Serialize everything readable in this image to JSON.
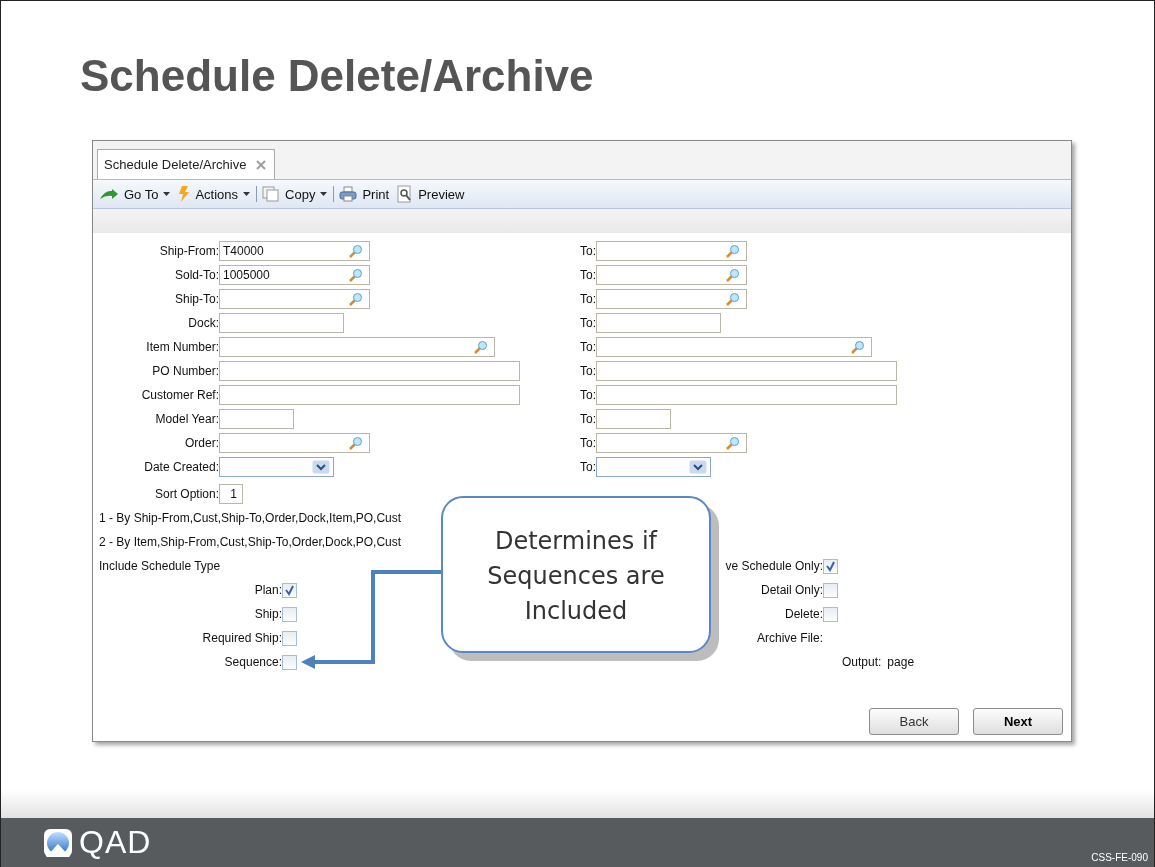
{
  "slide": {
    "title": "Schedule Delete/Archive",
    "logo": "QAD",
    "code": "CSS-FE-090"
  },
  "window": {
    "tabs": [
      {
        "label": "Schedule Delete/Archive",
        "selected": true
      }
    ],
    "toolbar": [
      {
        "kind": "goto",
        "label": "Go To",
        "dropdown": true,
        "separator_after": false
      },
      {
        "kind": "actions",
        "label": "Actions",
        "dropdown": true,
        "separator_after": true
      },
      {
        "kind": "copy",
        "label": "Copy",
        "dropdown": true,
        "separator_after": true
      },
      {
        "kind": "print",
        "label": "Print",
        "dropdown": false,
        "separator_after": false
      },
      {
        "kind": "preview",
        "label": "Preview",
        "dropdown": false,
        "separator_after": false
      }
    ]
  },
  "form": {
    "rows": [
      {
        "label": "Ship-From:",
        "value": "T40000",
        "kind": "lookup",
        "to_label": "To:"
      },
      {
        "label": "Sold-To:",
        "value": "1005000",
        "kind": "lookup",
        "to_label": "To:"
      },
      {
        "label": "Ship-To:",
        "kind": "lookup",
        "to_label": "To:"
      },
      {
        "label": "Dock:",
        "kind": "text",
        "to_label": "To:"
      },
      {
        "label": "Item Number:",
        "kind": "lookup-wide",
        "to_label": "To:"
      },
      {
        "label": "PO Number:",
        "kind": "text-wide",
        "to_label": "To:"
      },
      {
        "label": "Customer Ref:",
        "kind": "text-wide",
        "to_label": "To:"
      },
      {
        "label": "Model Year:",
        "kind": "text-narrow",
        "to_label": "To:"
      },
      {
        "label": "Order:",
        "kind": "lookup",
        "to_label": "To:"
      },
      {
        "label": "Date Created:",
        "kind": "date",
        "to_label": "To:"
      }
    ],
    "sort_option": {
      "label": "Sort Option:",
      "value": "1"
    },
    "sort_lines": [
      "1 - By  Ship-From,Cust,Ship-To,Order,Dock,Item,PO,Cust",
      "2 - By  Item,Ship-From,Cust,Ship-To,Order,Dock,PO,Cust"
    ],
    "include": {
      "heading": "Include Schedule Type",
      "items": [
        {
          "label": "Plan:",
          "checked": true
        },
        {
          "label": "Ship:",
          "checked": false
        },
        {
          "label": "Required Ship:",
          "checked": false
        },
        {
          "label": "Sequence:",
          "checked": false
        }
      ]
    },
    "options": [
      {
        "kind": "checkbox",
        "label": "ve Schedule Only:",
        "checked": true
      },
      {
        "kind": "checkbox",
        "label": "Detail Only:",
        "checked": false
      },
      {
        "kind": "checkbox",
        "label": "Delete:",
        "checked": false
      },
      {
        "kind": "text",
        "label": "Archive File:"
      }
    ],
    "output": {
      "label": "Output:",
      "value": "page"
    },
    "buttons": [
      {
        "label": "Back",
        "default": false
      },
      {
        "label": "Next",
        "default": true
      }
    ]
  },
  "callout": {
    "text": "Determines if Sequences are Included"
  }
}
